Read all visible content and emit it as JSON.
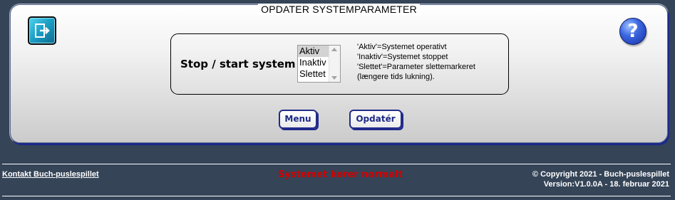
{
  "panel": {
    "title": "OPDATER SYSTEMPARAMETER"
  },
  "icons": {
    "exit": "exit-door-icon",
    "help": "help-question-icon",
    "help_glyph": "?"
  },
  "param": {
    "label": "Stop / start system",
    "options": [
      "Aktiv",
      "Inaktiv",
      "Slettet"
    ],
    "selected": "Aktiv",
    "help_lines": [
      "'Aktiv'=Systemet operativt",
      "'Inaktiv'=Systemet stoppet",
      "'Slettet'=Parameter slettemarkeret",
      "(længere tids lukning)."
    ]
  },
  "buttons": {
    "menu": "Menu",
    "update": "Opdatér"
  },
  "footer": {
    "contact": "Kontakt Buch-puslespillet",
    "status": "Systemet kører normalt",
    "copyright": "© Copyright 2021 - Buch-puslespillet",
    "version": "Version:V1.0.0A - 18. februar 2021"
  },
  "colors": {
    "background": "#354457",
    "button_text": "#1e2a86",
    "status": "#d10000"
  }
}
